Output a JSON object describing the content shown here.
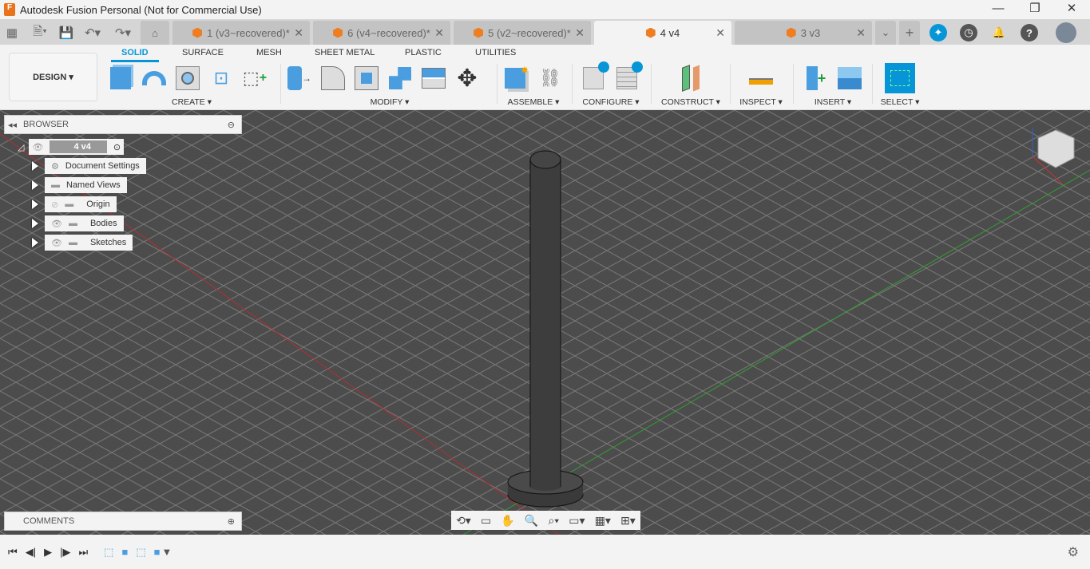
{
  "window": {
    "title": "Autodesk Fusion Personal (Not for Commercial Use)",
    "app_icon_letter": "F"
  },
  "tabs": [
    {
      "label": "1 (v3~recovered)*",
      "active": false
    },
    {
      "label": "6 (v4~recovered)*",
      "active": false
    },
    {
      "label": "5 (v2~recovered)*",
      "active": false
    },
    {
      "label": "4 v4",
      "active": true
    },
    {
      "label": "3 v3",
      "active": false
    }
  ],
  "workspace": "DESIGN",
  "ribbon_tabs": [
    "SOLID",
    "SURFACE",
    "MESH",
    "SHEET METAL",
    "PLASTIC",
    "UTILITIES"
  ],
  "groups": {
    "create": "CREATE ▾",
    "modify": "MODIFY ▾",
    "assemble": "ASSEMBLE ▾",
    "configure": "CONFIGURE ▾",
    "construct": "CONSTRUCT ▾",
    "inspect": "INSPECT ▾",
    "insert": "INSERT ▾",
    "select": "SELECT ▾"
  },
  "browser": {
    "title": "BROWSER",
    "root": "4 v4",
    "items": [
      "Document Settings",
      "Named Views",
      "Origin",
      "Bodies",
      "Sketches"
    ]
  },
  "comments": {
    "title": "COMMENTS"
  },
  "colors": {
    "accent": "#0696d7",
    "viewport": "#555555",
    "x_axis": "#b03030",
    "y_axis": "#30a030"
  }
}
